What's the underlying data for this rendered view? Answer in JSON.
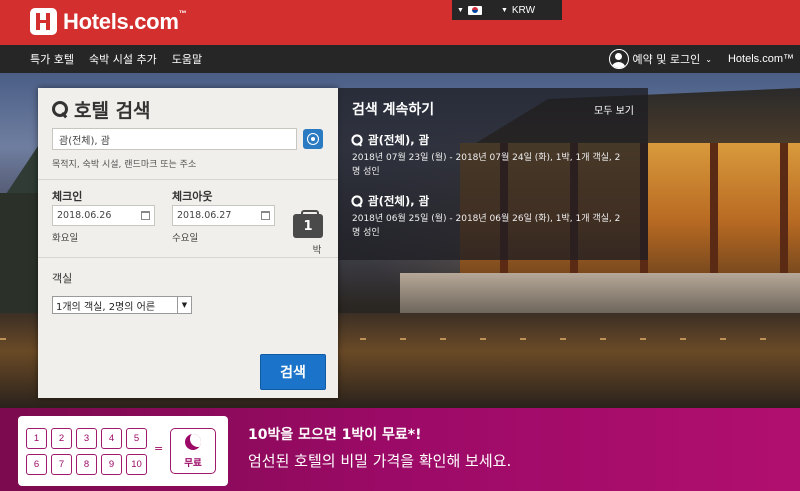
{
  "header": {
    "brand": "Hotels.com",
    "brand_tm": "™",
    "currency": "KRW",
    "flag_icon": "kr-flag-icon"
  },
  "nav": {
    "items": [
      {
        "label": "특가 호텔"
      },
      {
        "label": "숙박 시설 추가"
      },
      {
        "label": "도움말"
      }
    ],
    "login": "예약 및 로그인",
    "brand_link": "Hotels.com™"
  },
  "search": {
    "title": "호텔 검색",
    "destination_value": "괌(전체), 괌",
    "destination_hint": "목적지, 숙박 시설, 랜드마크 또는 주소",
    "checkin_label": "체크인",
    "checkin_value": "2018.06.26",
    "checkin_day": "화요일",
    "checkout_label": "체크아웃",
    "checkout_value": "2018.06.27",
    "checkout_day": "수요일",
    "nights_count": "1",
    "nights_unit": "박",
    "rooms_label": "객실",
    "rooms_value": "1개의 객실, 2명의 어른",
    "search_button": "검색"
  },
  "continue_search": {
    "title": "검색 계속하기",
    "view_all": "모두 보기",
    "items": [
      {
        "title": "괌(전체), 괌",
        "detail": "2018년 07월 23일 (월) - 2018년 07월 24일 (화), 1박, 1개 객실, 2명 성인"
      },
      {
        "title": "괌(전체), 괌",
        "detail": "2018년 06월 25일 (월) - 2018년 06월 26일 (화), 1박, 1개 객실, 2명 성인"
      }
    ]
  },
  "promo": {
    "stamps": [
      "1",
      "2",
      "3",
      "4",
      "5",
      "6",
      "7",
      "8",
      "9",
      "10"
    ],
    "equals": "=",
    "free_label": "무료",
    "title": "10박을 모으면 1박이 무료*!",
    "subtitle": "엄선된 호텔의 비밀 가격을 확인해 보세요."
  },
  "colors": {
    "header_red": "#d32f2f",
    "nav_dark": "#262626",
    "search_button_blue": "#1b74c9",
    "promo_magenta": "#9c0a67"
  }
}
